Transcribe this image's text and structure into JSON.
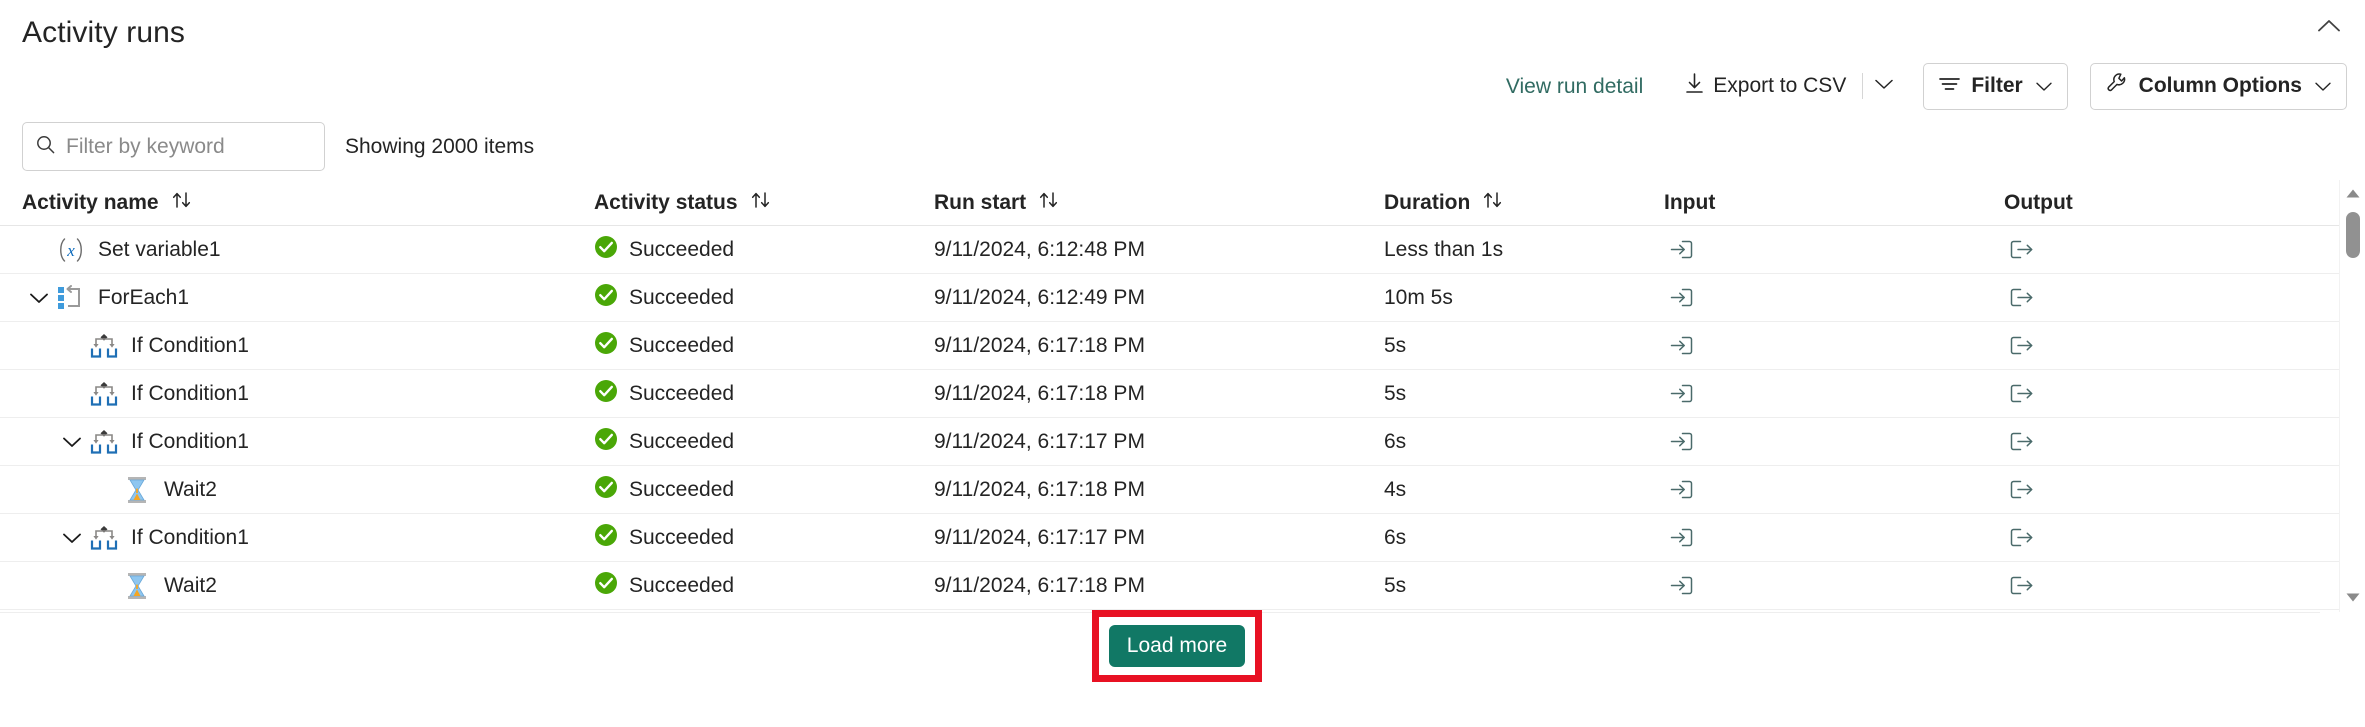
{
  "header": {
    "title": "Activity runs",
    "collapse_icon": "chevron-up-icon"
  },
  "toolbar": {
    "view_run_detail": "View run detail",
    "export_csv": "Export to CSV",
    "export_icon": "download-icon",
    "export_caret_icon": "chevron-down-icon",
    "filter": "Filter",
    "filter_icon": "filter-lines-icon",
    "filter_caret_icon": "chevron-down-icon",
    "column_options": "Column Options",
    "column_options_icon": "wrench-icon",
    "column_options_caret_icon": "chevron-down-icon"
  },
  "search": {
    "placeholder": "Filter by keyword",
    "value": "",
    "icon": "search-icon",
    "showing": "Showing 2000 items"
  },
  "table": {
    "columns": [
      {
        "label": "Activity name",
        "sortable": true,
        "sort_icon": "sort-updown-icon"
      },
      {
        "label": "Activity status",
        "sortable": true,
        "sort_icon": "sort-updown-icon"
      },
      {
        "label": "Run start",
        "sortable": true,
        "sort_icon": "sort-updown-icon"
      },
      {
        "label": "Duration",
        "sortable": true,
        "sort_icon": "sort-updown-icon"
      },
      {
        "label": "Input",
        "sortable": false,
        "sort_icon": ""
      },
      {
        "label": "Output",
        "sortable": false,
        "sort_icon": ""
      }
    ],
    "rows": [
      {
        "name": "Set variable1",
        "icon": "set-variable-icon",
        "indent": 0,
        "twisty": "none",
        "status": "Succeeded",
        "status_icon": "success-check-icon",
        "run_start": "9/11/2024, 6:12:48 PM",
        "duration": "Less than 1s",
        "input_icon": "arrow-into-box-icon",
        "output_icon": "arrow-out-of-box-icon"
      },
      {
        "name": "ForEach1",
        "icon": "foreach-loop-icon",
        "indent": 0,
        "twisty": "expanded",
        "status": "Succeeded",
        "status_icon": "success-check-icon",
        "run_start": "9/11/2024, 6:12:49 PM",
        "duration": "10m 5s",
        "input_icon": "arrow-into-box-icon",
        "output_icon": "arrow-out-of-box-icon"
      },
      {
        "name": "If Condition1",
        "icon": "if-condition-icon",
        "indent": 1,
        "twisty": "none",
        "status": "Succeeded",
        "status_icon": "success-check-icon",
        "run_start": "9/11/2024, 6:17:18 PM",
        "duration": "5s",
        "input_icon": "arrow-into-box-icon",
        "output_icon": "arrow-out-of-box-icon"
      },
      {
        "name": "If Condition1",
        "icon": "if-condition-icon",
        "indent": 1,
        "twisty": "none",
        "status": "Succeeded",
        "status_icon": "success-check-icon",
        "run_start": "9/11/2024, 6:17:18 PM",
        "duration": "5s",
        "input_icon": "arrow-into-box-icon",
        "output_icon": "arrow-out-of-box-icon"
      },
      {
        "name": "If Condition1",
        "icon": "if-condition-icon",
        "indent": 1,
        "twisty": "expanded",
        "status": "Succeeded",
        "status_icon": "success-check-icon",
        "run_start": "9/11/2024, 6:17:17 PM",
        "duration": "6s",
        "input_icon": "arrow-into-box-icon",
        "output_icon": "arrow-out-of-box-icon"
      },
      {
        "name": "Wait2",
        "icon": "hourglass-icon",
        "indent": 2,
        "twisty": "none",
        "status": "Succeeded",
        "status_icon": "success-check-icon",
        "run_start": "9/11/2024, 6:17:18 PM",
        "duration": "4s",
        "input_icon": "arrow-into-box-icon",
        "output_icon": "arrow-out-of-box-icon"
      },
      {
        "name": "If Condition1",
        "icon": "if-condition-icon",
        "indent": 1,
        "twisty": "expanded",
        "status": "Succeeded",
        "status_icon": "success-check-icon",
        "run_start": "9/11/2024, 6:17:17 PM",
        "duration": "6s",
        "input_icon": "arrow-into-box-icon",
        "output_icon": "arrow-out-of-box-icon"
      },
      {
        "name": "Wait2",
        "icon": "hourglass-icon",
        "indent": 2,
        "twisty": "none",
        "status": "Succeeded",
        "status_icon": "success-check-icon",
        "run_start": "9/11/2024, 6:17:18 PM",
        "duration": "5s",
        "input_icon": "arrow-into-box-icon",
        "output_icon": "arrow-out-of-box-icon"
      }
    ]
  },
  "scrollbar": {
    "up_icon": "scroll-up-arrow-icon",
    "down_icon": "scroll-down-arrow-icon"
  },
  "footer": {
    "load_more": "Load more"
  },
  "colors": {
    "accent_teal": "#117865",
    "link_teal": "#316b62",
    "success_green": "#4aa707",
    "highlight_red": "#e81123",
    "icon_blue": "#0f6cbd",
    "icon_gray": "#8a8886",
    "text": "#242424",
    "border": "#d1d1d1",
    "row_divider": "#eeeeee"
  }
}
